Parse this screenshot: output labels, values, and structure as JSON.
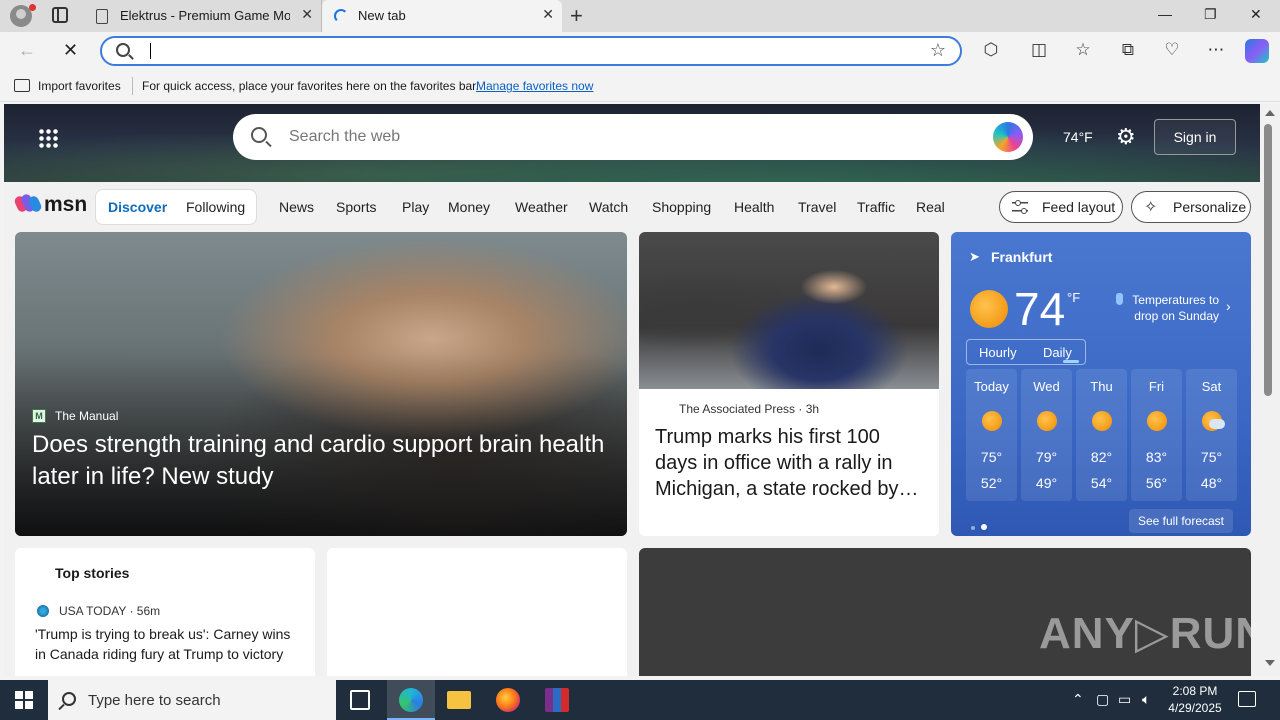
{
  "browser": {
    "tabs": [
      {
        "title": "Elektrus - Premium Game Mods",
        "close": "✕"
      },
      {
        "title": "New tab",
        "close": "✕"
      }
    ],
    "new_tab": "+",
    "window": {
      "minimize": "—",
      "restore": "❐",
      "close": "✕"
    },
    "address": {
      "value": "",
      "placeholder": ""
    },
    "favorites": {
      "import_label": "Import favorites",
      "hint": "For quick access, place your favorites here on the favorites bar.",
      "manage_link": "Manage favorites now"
    }
  },
  "msn": {
    "search_placeholder": "Search the web",
    "temperature": "74°F",
    "sign_in": "Sign in",
    "logo_text": "msn",
    "feed_tabs": {
      "discover": "Discover",
      "following": "Following"
    },
    "nav": [
      "News",
      "Sports",
      "Play",
      "Money",
      "Weather",
      "Watch",
      "Shopping",
      "Health",
      "Travel",
      "Traffic",
      "Real Estate"
    ],
    "feed_layout": "Feed layout",
    "personalize": "Personalize",
    "main_story": {
      "source_icon": "M",
      "source": "The Manual",
      "title": "Does strength training and cardio support brain health later in life? New study"
    },
    "second_story": {
      "source": "The Associated Press · 3h",
      "title": "Trump marks his first 100 days in office with a rally in Michigan, a state rocked by…"
    },
    "weather": {
      "location": "Frankfurt",
      "temp": "74",
      "unit": "°F",
      "note": "Temperatures to drop on Sunday",
      "toggle": {
        "hourly": "Hourly",
        "daily": "Daily"
      },
      "days": [
        {
          "name": "Today",
          "hi": "75°",
          "lo": "52°",
          "icon": "sun-icon"
        },
        {
          "name": "Wed",
          "hi": "79°",
          "lo": "49°",
          "icon": "sun-icon"
        },
        {
          "name": "Thu",
          "hi": "82°",
          "lo": "54°",
          "icon": "sun-icon"
        },
        {
          "name": "Fri",
          "hi": "83°",
          "lo": "56°",
          "icon": "sun-icon"
        },
        {
          "name": "Sat",
          "hi": "75°",
          "lo": "48°",
          "icon": "partly-cloudy-icon"
        }
      ],
      "full_forecast": "See full forecast"
    },
    "top_stories": {
      "heading": "Top stories",
      "source": "USA TODAY · 56m",
      "title": "'Trump is trying to break us': Carney wins in Canada riding fury at Trump to victory"
    },
    "watermark": "ANY▷RUN"
  },
  "taskbar": {
    "search_placeholder": "Type here to search",
    "time": "2:08 PM",
    "date": "4/29/2025"
  }
}
